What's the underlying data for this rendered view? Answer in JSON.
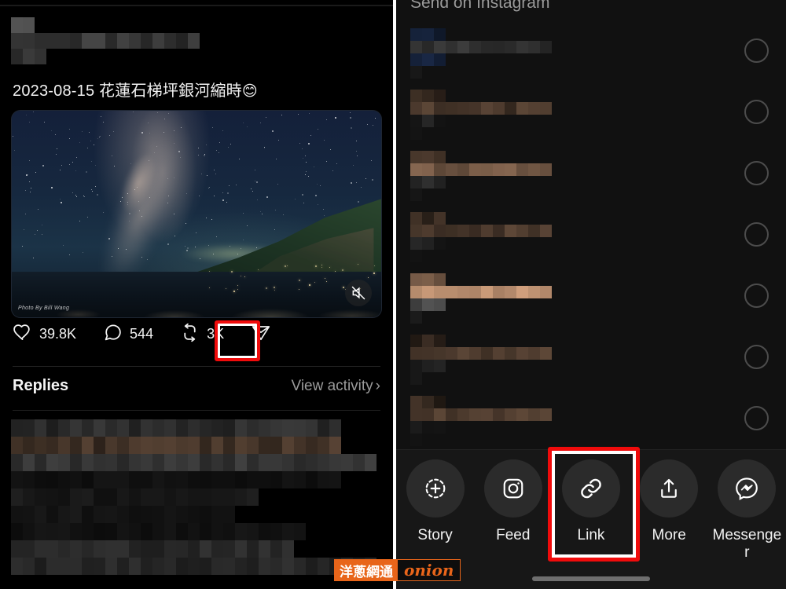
{
  "left_panel": {
    "post": {
      "caption": "2023-08-15 花蓮石梯坪銀河縮時",
      "caption_emoji": "😊",
      "author_censored": true,
      "media": {
        "type": "video",
        "description": "Milky Way night sky over coastline",
        "photo_credit": "Photo By Bill Wang",
        "mute_icon": "speaker-muted-icon"
      }
    },
    "actions": [
      {
        "name": "like",
        "icon": "heart-icon",
        "count": "39.8K"
      },
      {
        "name": "reply",
        "icon": "comment-icon",
        "count": "544"
      },
      {
        "name": "repost",
        "icon": "repost-icon",
        "count": "3K"
      },
      {
        "name": "share",
        "icon": "paper-plane-icon",
        "count": "",
        "highlighted": true
      }
    ],
    "replies_section": {
      "title": "Replies",
      "view_activity": "View activity",
      "chevron": "›"
    }
  },
  "right_panel": {
    "sheet_title": "Send on Instagram",
    "contacts": [
      {
        "name_censored": true,
        "selected": false
      },
      {
        "name_censored": true,
        "selected": false
      },
      {
        "name_censored": true,
        "selected": false
      },
      {
        "name_censored": true,
        "selected": false
      },
      {
        "name_censored": true,
        "selected": false
      },
      {
        "name_censored": true,
        "selected": false
      },
      {
        "name_censored": true,
        "selected": false
      }
    ],
    "share_options": [
      {
        "label": "Story",
        "icon": "add-to-story-icon",
        "highlighted": false
      },
      {
        "label": "Feed",
        "icon": "instagram-camera-icon",
        "highlighted": false
      },
      {
        "label": "Link",
        "icon": "link-chain-icon",
        "highlighted": true
      },
      {
        "label": "More",
        "icon": "share-out-icon",
        "highlighted": false
      },
      {
        "label": "Messenger",
        "icon": "messenger-icon",
        "highlighted": false
      }
    ]
  },
  "watermark": {
    "chinese": "洋蔥網通",
    "english": "onion"
  },
  "colors": {
    "highlight_red": "#f00b0b",
    "background": "#000000",
    "sheet_background": "#171717",
    "watermark_orange": "#e8651a"
  }
}
